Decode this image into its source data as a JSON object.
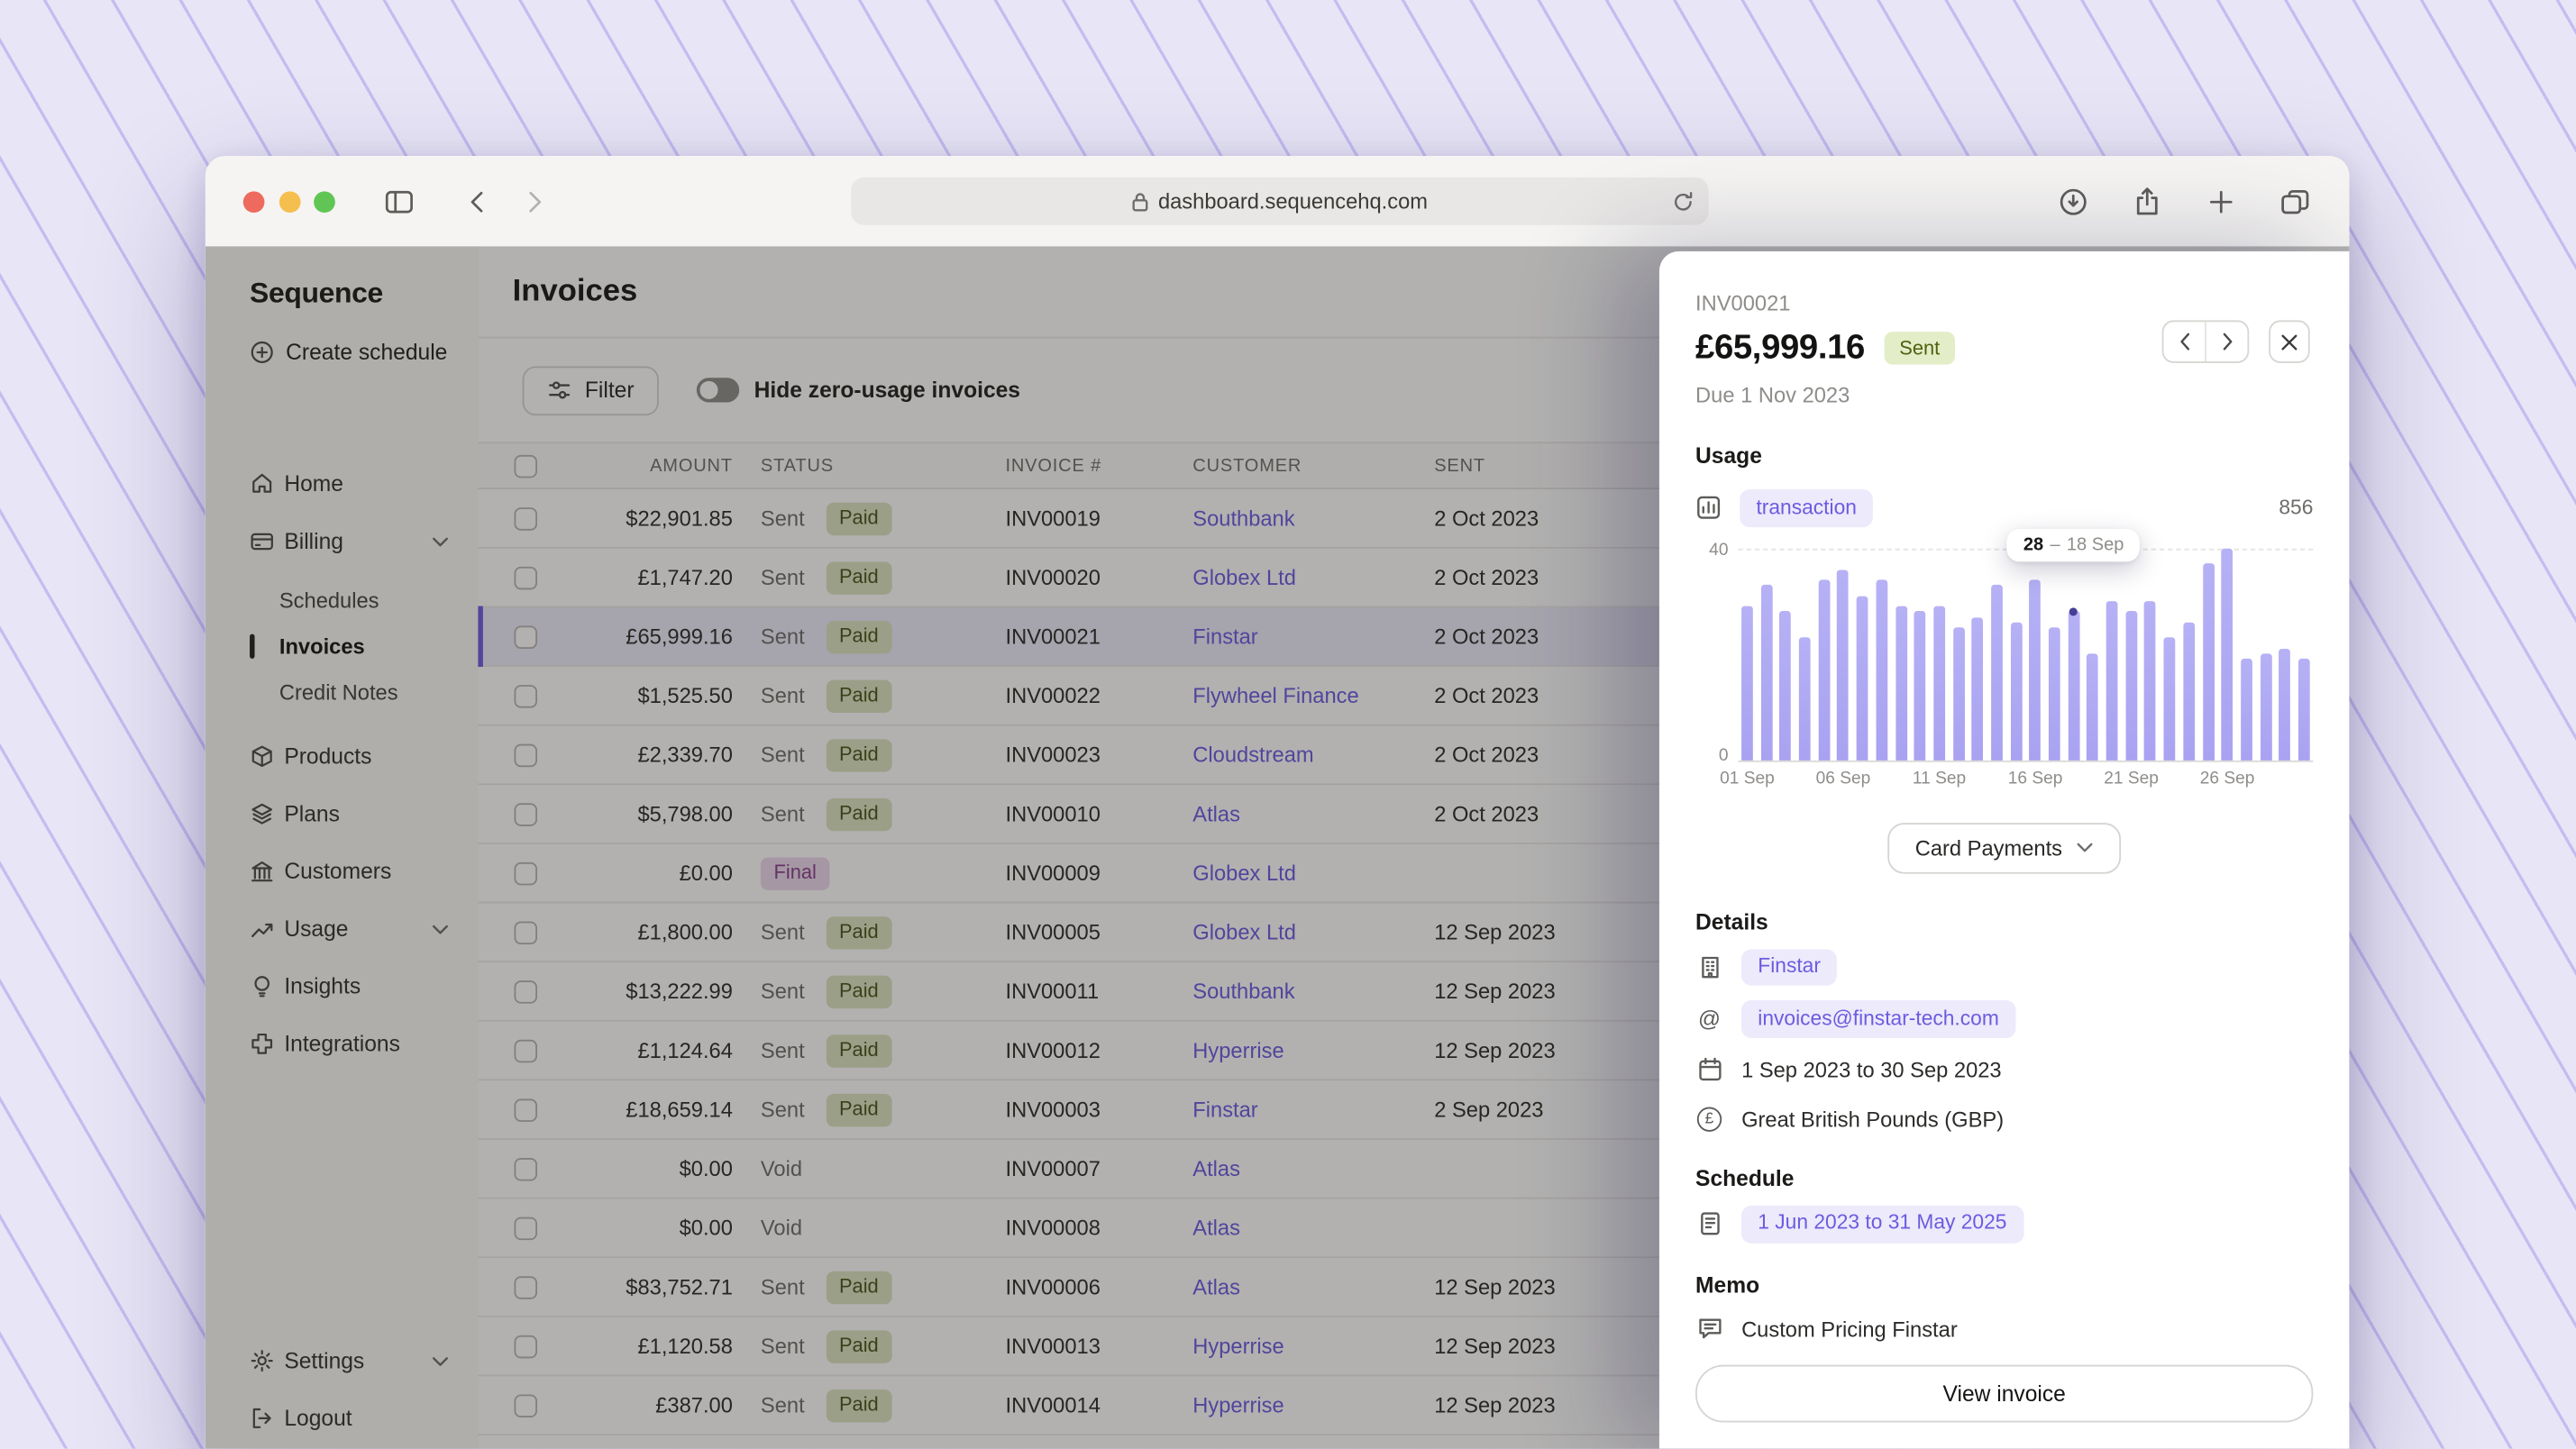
{
  "theme": {
    "accent": "#6c5be0",
    "tag_bg": "#eceafb",
    "paid_bg": "#dce4c0",
    "paid_text": "#49531c",
    "final_bg": "#ecd8ec",
    "final_text": "#8a3f8f",
    "sent_badge_bg": "#e3edc8",
    "sent_badge_text": "#50600f",
    "bar_color": "#a9a2f1"
  },
  "browser": {
    "url": "dashboard.sequencehq.com",
    "window_buttons": [
      "close",
      "minimize",
      "zoom"
    ],
    "icons": [
      "sidebar-toggle-icon",
      "back-icon",
      "forward-icon",
      "lock-icon",
      "reload-icon",
      "download-icon",
      "share-icon",
      "new-tab-icon",
      "tab-overview-icon"
    ]
  },
  "app": {
    "logo": "Sequence",
    "create_schedule_label": "Create schedule",
    "nav": [
      {
        "label": "Home",
        "icon": "home-icon"
      },
      {
        "label": "Billing",
        "icon": "billing-icon",
        "chevron": true,
        "expanded": true,
        "children": [
          {
            "label": "Schedules",
            "active": false
          },
          {
            "label": "Invoices",
            "active": true
          },
          {
            "label": "Credit Notes",
            "active": false
          }
        ]
      },
      {
        "label": "Products",
        "icon": "products-icon"
      },
      {
        "label": "Plans",
        "icon": "plans-icon"
      },
      {
        "label": "Customers",
        "icon": "customers-icon"
      },
      {
        "label": "Usage",
        "icon": "usage-icon",
        "chevron": true
      },
      {
        "label": "Insights",
        "icon": "insights-icon"
      },
      {
        "label": "Integrations",
        "icon": "integrations-icon"
      }
    ],
    "nav_footer": [
      {
        "label": "Settings",
        "icon": "settings-icon",
        "chevron": true
      },
      {
        "label": "Logout",
        "icon": "logout-icon"
      }
    ]
  },
  "main": {
    "title": "Invoices",
    "filter_label": "Filter",
    "toggle_label": "Hide zero-usage invoices",
    "toggle_on": false,
    "table": {
      "columns": [
        "AMOUNT",
        "STATUS",
        "INVOICE #",
        "CUSTOMER",
        "SENT"
      ],
      "rows": [
        {
          "amount": "$22,901.85",
          "status": [
            "Sent",
            "Paid"
          ],
          "invoice": "INV00019",
          "customer": "Southbank",
          "sent": "2 Oct 2023"
        },
        {
          "amount": "£1,747.20",
          "status": [
            "Sent",
            "Paid"
          ],
          "invoice": "INV00020",
          "customer": "Globex Ltd",
          "sent": "2 Oct 2023"
        },
        {
          "amount": "£65,999.16",
          "status": [
            "Sent",
            "Paid"
          ],
          "invoice": "INV00021",
          "customer": "Finstar",
          "sent": "2 Oct 2023",
          "selected": true
        },
        {
          "amount": "$1,525.50",
          "status": [
            "Sent",
            "Paid"
          ],
          "invoice": "INV00022",
          "customer": "Flywheel Finance",
          "sent": "2 Oct 2023"
        },
        {
          "amount": "£2,339.70",
          "status": [
            "Sent",
            "Paid"
          ],
          "invoice": "INV00023",
          "customer": "Cloudstream",
          "sent": "2 Oct 2023"
        },
        {
          "amount": "$5,798.00",
          "status": [
            "Sent",
            "Paid"
          ],
          "invoice": "INV00010",
          "customer": "Atlas",
          "sent": "2 Oct 2023"
        },
        {
          "amount": "£0.00",
          "status": [
            "Final"
          ],
          "invoice": "INV00009",
          "customer": "Globex Ltd",
          "sent": ""
        },
        {
          "amount": "£1,800.00",
          "status": [
            "Sent",
            "Paid"
          ],
          "invoice": "INV00005",
          "customer": "Globex Ltd",
          "sent": "12 Sep 2023"
        },
        {
          "amount": "$13,222.99",
          "status": [
            "Sent",
            "Paid"
          ],
          "invoice": "INV00011",
          "customer": "Southbank",
          "sent": "12 Sep 2023"
        },
        {
          "amount": "£1,124.64",
          "status": [
            "Sent",
            "Paid"
          ],
          "invoice": "INV00012",
          "customer": "Hyperrise",
          "sent": "12 Sep 2023"
        },
        {
          "amount": "£18,659.14",
          "status": [
            "Sent",
            "Paid"
          ],
          "invoice": "INV00003",
          "customer": "Finstar",
          "sent": "2 Sep 2023"
        },
        {
          "amount": "$0.00",
          "status": [
            "Void"
          ],
          "invoice": "INV00007",
          "customer": "Atlas",
          "sent": ""
        },
        {
          "amount": "$0.00",
          "status": [
            "Void"
          ],
          "invoice": "INV00008",
          "customer": "Atlas",
          "sent": ""
        },
        {
          "amount": "$83,752.71",
          "status": [
            "Sent",
            "Paid"
          ],
          "invoice": "INV00006",
          "customer": "Atlas",
          "sent": "12 Sep 2023"
        },
        {
          "amount": "£1,120.58",
          "status": [
            "Sent",
            "Paid"
          ],
          "invoice": "INV00013",
          "customer": "Hyperrise",
          "sent": "12 Sep 2023"
        },
        {
          "amount": "£387.00",
          "status": [
            "Sent",
            "Paid"
          ],
          "invoice": "INV00014",
          "customer": "Hyperrise",
          "sent": "12 Sep 2023"
        }
      ]
    }
  },
  "panel": {
    "invoice_id": "INV00021",
    "amount": "£65,999.16",
    "status_badge": "Sent",
    "due": "Due 1 Nov 2023",
    "usage_section": {
      "title": "Usage",
      "metric_tag": "transaction",
      "total": "856",
      "dropdown_value": "Card Payments"
    },
    "details_section": {
      "title": "Details",
      "customer_tag": "Finstar",
      "email_tag": "invoices@finstar-tech.com",
      "billing_period": "1 Sep 2023 to 30 Sep 2023",
      "currency": "Great British Pounds (GBP)",
      "icons": [
        "building-icon",
        "at-sign-icon",
        "calendar-icon",
        "currency-pound-icon"
      ]
    },
    "schedule_section": {
      "title": "Schedule",
      "date_range_tag": "1 Jun 2023 to 31 May 2025"
    },
    "memo_section": {
      "title": "Memo",
      "text": "Custom Pricing Finstar"
    },
    "view_invoice_label": "View invoice"
  },
  "chart_data": {
    "type": "bar",
    "series_name": "transaction",
    "total": 856,
    "ylim": [
      0,
      40
    ],
    "y_ticks": [
      0,
      40
    ],
    "x_ticks": [
      "01 Sep",
      "06 Sep",
      "11 Sep",
      "16 Sep",
      "21 Sep",
      "26 Sep"
    ],
    "values": [
      29,
      33,
      28,
      23,
      34,
      36,
      31,
      34,
      29,
      28,
      29,
      25,
      27,
      33,
      26,
      34,
      25,
      28,
      20,
      30,
      28,
      30,
      23,
      26,
      37,
      40,
      19,
      20,
      21,
      19
    ],
    "highlight": {
      "index": 17,
      "value": 28,
      "date": "18 Sep",
      "separator": "–"
    },
    "bar_color": "#a9a2f1",
    "grid": "dashed-top",
    "legend_position": "none"
  }
}
